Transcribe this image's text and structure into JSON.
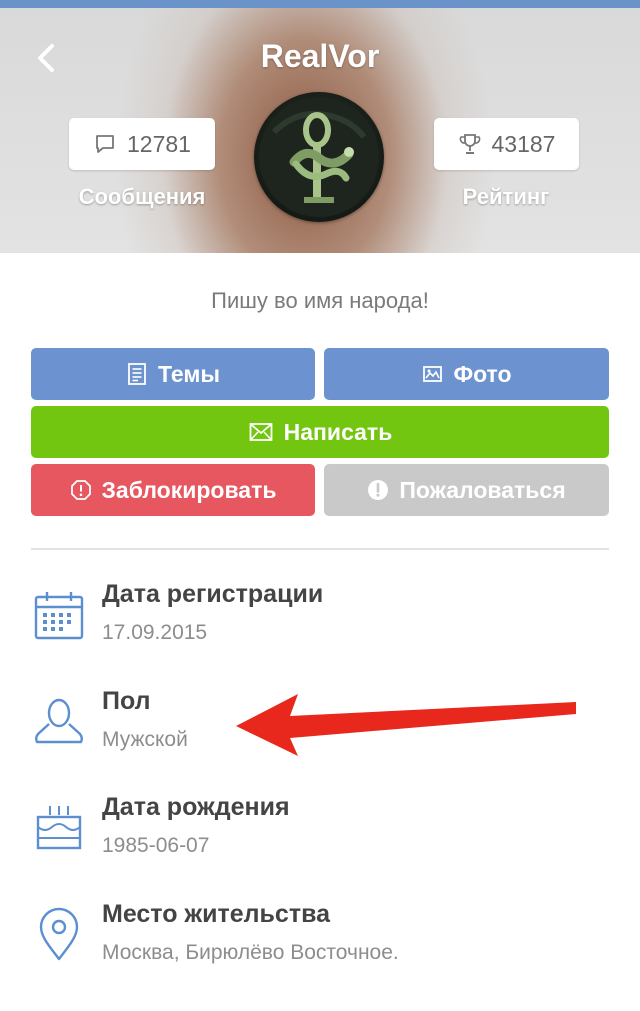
{
  "header": {
    "username": "RealVor",
    "messages_count": "12781",
    "messages_label": "Сообщения",
    "rating_count": "43187",
    "rating_label": "Рейтинг"
  },
  "profile": {
    "motto": "Пишу во имя народа!"
  },
  "actions": {
    "topics_label": "Темы",
    "photo_label": "Фото",
    "write_label": "Написать",
    "block_label": "Заблокировать",
    "report_label": "Пожаловаться"
  },
  "info": [
    {
      "title": "Дата регистрации",
      "value": "17.09.2015",
      "icon": "calendar-icon"
    },
    {
      "title": "Пол",
      "value": "Мужской",
      "icon": "person-icon"
    },
    {
      "title": "Дата рождения",
      "value": "1985-06-07",
      "icon": "cake-icon"
    },
    {
      "title": "Место жительства",
      "value": "Москва, Бирюлёво Восточное.",
      "icon": "location-pin-icon"
    }
  ],
  "colors": {
    "primary_blue": "#6c93cf",
    "write_green": "#72c60f",
    "block_red": "#e6575f",
    "report_gray": "#c9c9c9",
    "icon_blue": "#5b8fd0",
    "annotation_arrow_red": "#e8281c"
  }
}
